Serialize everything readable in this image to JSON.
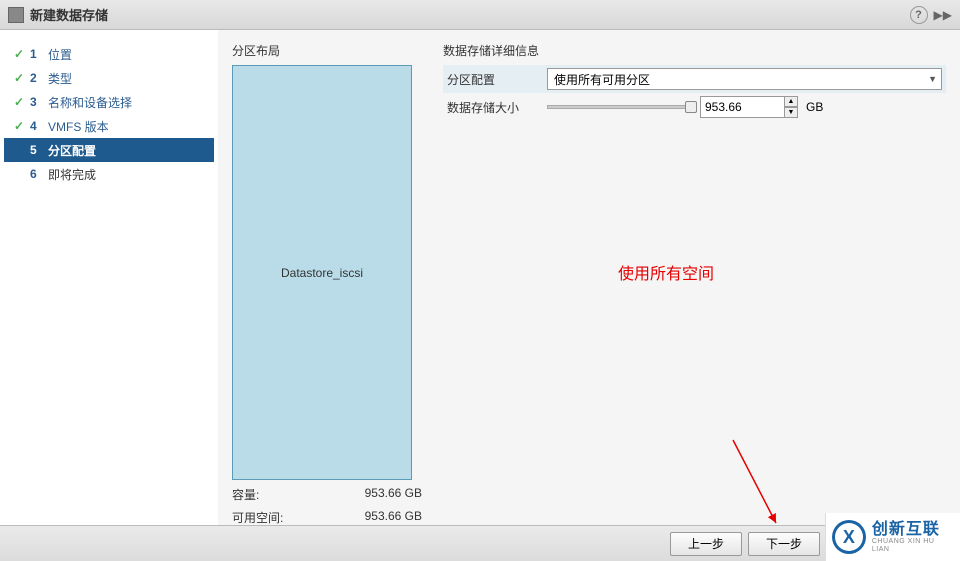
{
  "title": "新建数据存储",
  "steps": [
    {
      "num": "1",
      "label": "位置",
      "status": "completed"
    },
    {
      "num": "2",
      "label": "类型",
      "status": "completed"
    },
    {
      "num": "3",
      "label": "名称和设备选择",
      "status": "completed"
    },
    {
      "num": "4",
      "label": "VMFS 版本",
      "status": "completed"
    },
    {
      "num": "5",
      "label": "分区配置",
      "status": "current"
    },
    {
      "num": "6",
      "label": "即将完成",
      "status": "future"
    }
  ],
  "layout": {
    "title": "分区布局",
    "datastore_name": "Datastore_iscsi",
    "capacity_label": "容量:",
    "capacity_value": "953.66 GB",
    "free_label": "可用空间:",
    "free_value": "953.66 GB"
  },
  "details": {
    "title": "数据存储详细信息",
    "partition_config_label": "分区配置",
    "partition_config_value": "使用所有可用分区",
    "size_label": "数据存储大小",
    "size_value": "953.66",
    "size_unit": "GB"
  },
  "annotation": "使用所有空间",
  "buttons": {
    "back": "上一步",
    "next": "下一步"
  },
  "watermark": {
    "cn": "创新互联",
    "en": "CHUANG XIN HU LIAN"
  }
}
